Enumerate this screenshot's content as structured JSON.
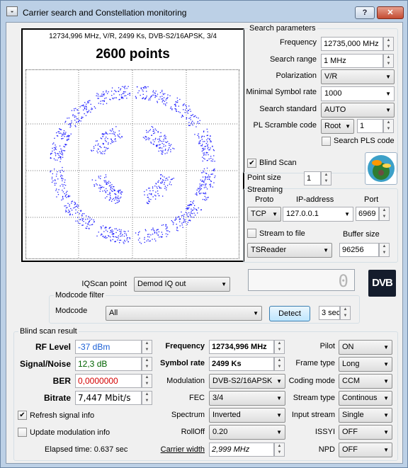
{
  "window": {
    "title": "Carrier search and Constellation monitoring",
    "help_label": "?",
    "close_label": "✕",
    "app_icon": "satellite-app-icon"
  },
  "constellation": {
    "info": "12734,996 MHz, V/R, 2499 Ks, DVB-S2/16APSK, 3/4",
    "points": "2600 points"
  },
  "search_params": {
    "title": "Search parameters",
    "frequency_label": "Frequency",
    "frequency_value": "12735,000 MHz",
    "range_label": "Search range",
    "range_value": "1 MHz",
    "polarization_label": "Polarization",
    "polarization_value": "V/R",
    "min_sr_label": "Minimal Symbol rate",
    "min_sr_value": "1000",
    "standard_label": "Search standard",
    "standard_value": "AUTO",
    "pls_label": "PL Scramble code",
    "pls_mode": "Root",
    "pls_value": "1",
    "search_pls_label": "Search PLS code"
  },
  "blind_scan": {
    "label": "Blind Scan",
    "checked": true,
    "point_size_label": "Point size",
    "point_size_value": "1"
  },
  "streaming": {
    "title": "Streaming",
    "proto_label": "Proto",
    "ip_label": "IP-address",
    "port_label": "Port",
    "proto_value": "TCP",
    "ip_value": "127.0.0.1",
    "port_value": "6969",
    "stream_to_file_label": "Stream to file",
    "buffer_label": "Buffer size",
    "reader_value": "TSReader",
    "buffer_value": "96256"
  },
  "iqscan": {
    "label": "IQScan point",
    "value": "Demod IQ out"
  },
  "lcd": {
    "value": "0"
  },
  "modcode_filter": {
    "title": "Modcode filter",
    "modcode_label": "Modcode",
    "modcode_value": "All",
    "detect_label": "Detect",
    "interval_value": "3 sec"
  },
  "dvb_logo": {
    "text": "DVB"
  },
  "result": {
    "title": "Blind scan result",
    "rf_label": "RF Level",
    "rf_value": "-37 dBm",
    "snr_label": "Signal/Noise",
    "snr_value": "12,3 dB",
    "ber_label": "BER",
    "ber_value": "0,0000000",
    "bitrate_label": "Bitrate",
    "bitrate_value": "7,447 Mbit/s",
    "refresh_label": "Refresh signal info",
    "refresh_checked": true,
    "update_mod_label": "Update modulation info",
    "update_mod_checked": false,
    "elapsed": "Elapsed time: 0.637 sec",
    "frequency_label": "Frequency",
    "frequency_value": "12734,996 MHz",
    "sr_label": "Symbol rate",
    "sr_value": "2499 Ks",
    "modulation_label": "Modulation",
    "modulation_value": "DVB-S2/16APSK",
    "fec_label": "FEC",
    "fec_value": "3/4",
    "spectrum_label": "Spectrum",
    "spectrum_value": "Inverted",
    "rolloff_label": "RollOff",
    "rolloff_value": "0.20",
    "carrier_width_label": "Carrier width",
    "carrier_width_value": "2,999 MHz",
    "pilot_label": "Pilot",
    "pilot_value": "ON",
    "frame_label": "Frame type",
    "frame_value": "Long",
    "coding_label": "Coding mode",
    "coding_value": "CCM",
    "stream_type_label": "Stream type",
    "stream_type_value": "Continous",
    "input_stream_label": "Input stream",
    "input_stream_value": "Single",
    "issyi_label": "ISSYI",
    "issyi_value": "OFF",
    "npd_label": "NPD",
    "npd_value": "OFF"
  },
  "colors": {
    "title_bar": "#bcd0e6",
    "constellation_dots": "#1c1cff",
    "rf_value": "#1a5fd6",
    "snr_value": "#006400",
    "ber_value": "#d40000"
  }
}
